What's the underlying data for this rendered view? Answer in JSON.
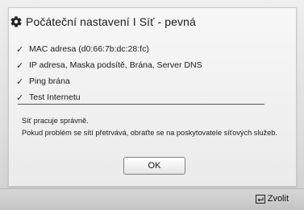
{
  "dialog": {
    "title": "Počáteční nastavení I Síť - pevná",
    "icon": "gear-icon"
  },
  "checks": [
    {
      "label": "MAC adresa (d0:66:7b:dc:28:fc)",
      "icon": "checkmark-icon"
    },
    {
      "label": "IP adresa, Maska podsítě, Brána, Server DNS",
      "icon": "checkmark-icon"
    },
    {
      "label": "Ping brána",
      "icon": "checkmark-icon"
    },
    {
      "label": "Test Internetu",
      "icon": "checkmark-icon"
    }
  ],
  "message": {
    "line1": "Síť pracuje správně.",
    "line2": "Pokud problém se sítí přetrvává, obraťte se na poskytovatele síťových služeb."
  },
  "buttons": {
    "ok_label": "OK"
  },
  "footer": {
    "select_label": "Zvolit",
    "select_icon": "enter-key-icon"
  }
}
